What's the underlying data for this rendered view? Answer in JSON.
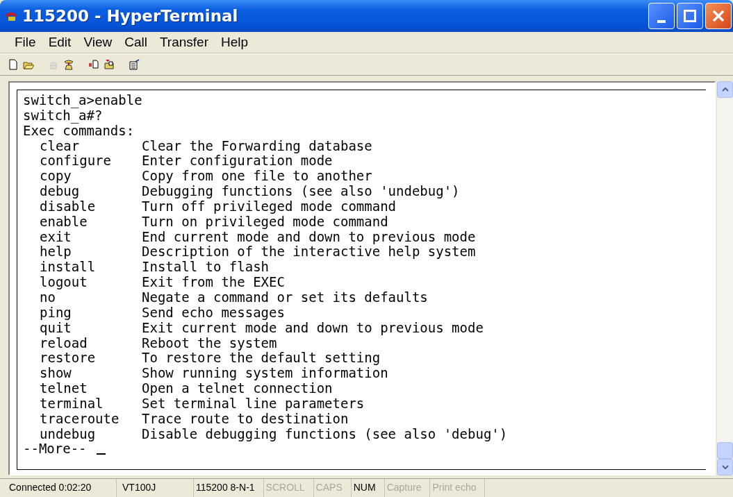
{
  "window": {
    "title": "115200 - HyperTerminal"
  },
  "menu": [
    {
      "label": "File"
    },
    {
      "label": "Edit"
    },
    {
      "label": "View"
    },
    {
      "label": "Call"
    },
    {
      "label": "Transfer"
    },
    {
      "label": "Help"
    }
  ],
  "toolbar": [
    {
      "kind": "new",
      "disabled": false
    },
    {
      "kind": "open",
      "disabled": false
    },
    {
      "kind": "disconnect",
      "disabled": true
    },
    {
      "kind": "call",
      "disabled": false
    },
    {
      "kind": "send",
      "disabled": false
    },
    {
      "kind": "receive",
      "disabled": false
    },
    {
      "kind": "properties",
      "disabled": false
    }
  ],
  "terminal": {
    "lines": [
      {
        "kind": "text",
        "text": "switch_a>enable"
      },
      {
        "kind": "text",
        "text": "switch_a#?"
      },
      {
        "kind": "text",
        "text": "Exec commands:"
      },
      {
        "kind": "command",
        "command": "clear",
        "description": "Clear the Forwarding database"
      },
      {
        "kind": "command",
        "command": "configure",
        "description": "Enter configuration mode"
      },
      {
        "kind": "command",
        "command": "copy",
        "description": "Copy from one file to another"
      },
      {
        "kind": "command",
        "command": "debug",
        "description": "Debugging functions (see also 'undebug')"
      },
      {
        "kind": "command",
        "command": "disable",
        "description": "Turn off privileged mode command"
      },
      {
        "kind": "command",
        "command": "enable",
        "description": "Turn on privileged mode command"
      },
      {
        "kind": "command",
        "command": "exit",
        "description": "End current mode and down to previous mode"
      },
      {
        "kind": "command",
        "command": "help",
        "description": "Description of the interactive help system"
      },
      {
        "kind": "command",
        "command": "install",
        "description": "Install to flash"
      },
      {
        "kind": "command",
        "command": "logout",
        "description": "Exit from the EXEC"
      },
      {
        "kind": "command",
        "command": "no",
        "description": "Negate a command or set its defaults"
      },
      {
        "kind": "command",
        "command": "ping",
        "description": "Send echo messages"
      },
      {
        "kind": "command",
        "command": "quit",
        "description": "Exit current mode and down to previous mode"
      },
      {
        "kind": "command",
        "command": "reload",
        "description": "Reboot the system"
      },
      {
        "kind": "command",
        "command": "restore",
        "description": "To restore the default setting"
      },
      {
        "kind": "command",
        "command": "show",
        "description": "Show running system information"
      },
      {
        "kind": "command",
        "command": "telnet",
        "description": "Open a telnet connection"
      },
      {
        "kind": "command",
        "command": "terminal",
        "description": "Set terminal line parameters"
      },
      {
        "kind": "command",
        "command": "traceroute",
        "description": "Trace route to destination"
      },
      {
        "kind": "command",
        "command": "undebug",
        "description": "Disable debugging functions (see also 'debug')"
      },
      {
        "kind": "prompt",
        "text": "--More--"
      }
    ]
  },
  "status_bar": [
    {
      "text": "Connected 0:02:20",
      "disabled": false
    },
    {
      "text": "VT100J",
      "disabled": false
    },
    {
      "text": "115200 8-N-1",
      "disabled": false
    },
    {
      "text": "SCROLL",
      "disabled": true
    },
    {
      "text": "CAPS",
      "disabled": true
    },
    {
      "text": "NUM",
      "disabled": false
    },
    {
      "text": "Capture",
      "disabled": true
    },
    {
      "text": "Print echo",
      "disabled": true
    }
  ]
}
